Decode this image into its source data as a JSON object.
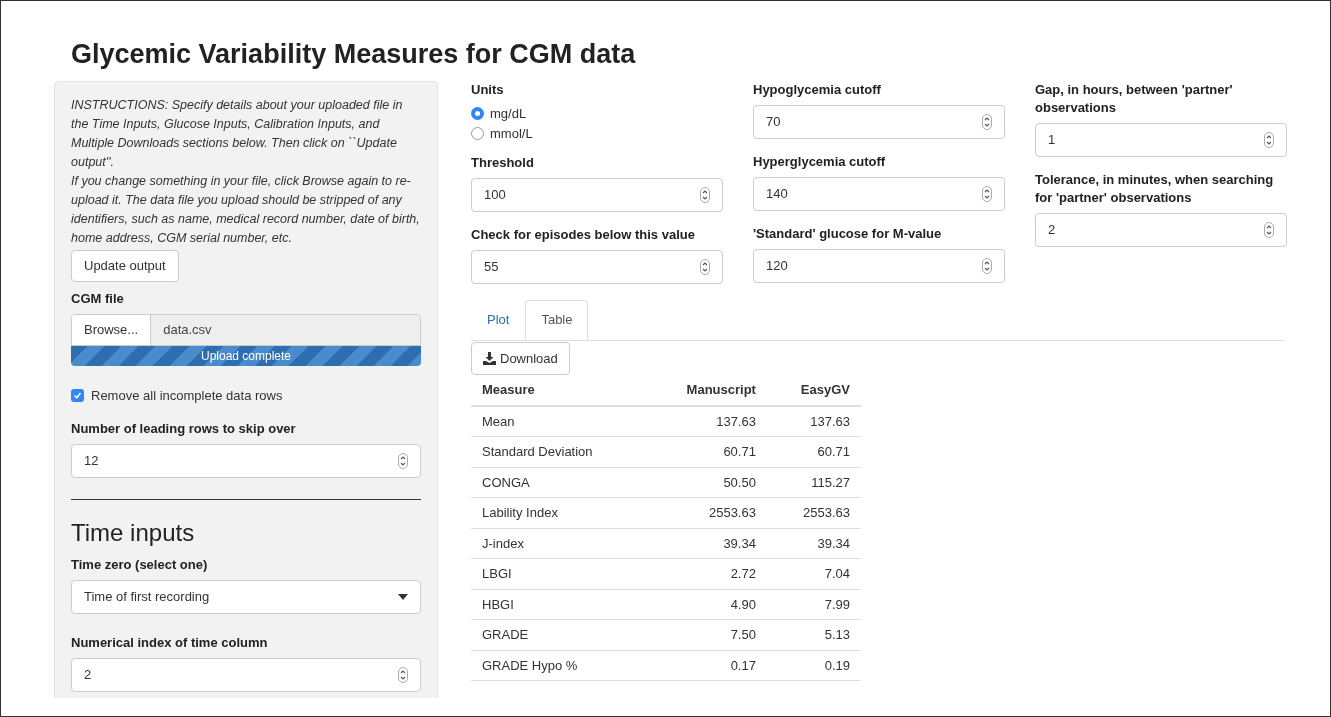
{
  "title": "Glycemic Variability Measures for CGM data",
  "sidebar": {
    "instructions": [
      "INSTRUCTIONS: Specify details about your uploaded file in the Time Inputs, Glucose Inputs, Calibration Inputs, and Multiple Downloads sections below. Then click on ``Update output''.",
      "If you change something in your file, click Browse again to re-upload it. The data file you upload should be stripped of any identifiers, such as name, medical record number, date of birth, home address, CGM serial number, etc."
    ],
    "update_button": "Update output",
    "cgm_file": {
      "label": "CGM file",
      "browse_button": "Browse...",
      "filename": "data.csv",
      "progress": {
        "label": "Upload complete",
        "level": 1
      }
    },
    "remove_incomplete": {
      "label": "Remove all incomplete data rows",
      "checked": true
    },
    "skip_rows": {
      "label": "Number of leading rows to skip over",
      "value": "12"
    },
    "section_heading": "Time inputs",
    "time_zero": {
      "label": "Time zero (select one)",
      "value": "Time of first recording"
    },
    "time_column": {
      "label": "Numerical index of time column",
      "value": "2"
    }
  },
  "settings_columns": [
    {
      "items": [
        {
          "kind": "radio",
          "label": "Units",
          "options": [
            {
              "label": "mg/dL",
              "selected": true
            },
            {
              "label": "mmol/L",
              "selected": false
            }
          ]
        },
        {
          "kind": "number",
          "label": "Threshold",
          "value": "100"
        },
        {
          "kind": "number",
          "label": "Check for episodes below this value",
          "value": "55"
        }
      ]
    },
    {
      "items": [
        {
          "kind": "number",
          "label": "Hypoglycemia cutoff",
          "value": "70"
        },
        {
          "kind": "number",
          "label": "Hyperglycemia cutoff",
          "value": "140"
        },
        {
          "kind": "number",
          "label": "'Standard' glucose for M-value",
          "value": "120"
        }
      ]
    },
    {
      "items": [
        {
          "kind": "number",
          "label": "Gap, in hours, between 'partner' observations",
          "value": "1"
        },
        {
          "kind": "number",
          "label": "Tolerance, in minutes, when searching for 'partner' observations",
          "value": "2"
        }
      ]
    }
  ],
  "tabs": [
    {
      "label": "Plot",
      "selected": false
    },
    {
      "label": "Table",
      "selected": true
    }
  ],
  "download_button": "Download",
  "table": {
    "columns": [
      "Measure",
      "Manuscript",
      "EasyGV"
    ],
    "rows": [
      [
        "Mean",
        "137.63",
        "137.63"
      ],
      [
        "Standard Deviation",
        "60.71",
        "60.71"
      ],
      [
        "CONGA",
        "50.50",
        "115.27"
      ],
      [
        "Lability Index",
        "2553.63",
        "2553.63"
      ],
      [
        "J-index",
        "39.34",
        "39.34"
      ],
      [
        "LBGI",
        "2.72",
        "7.04"
      ],
      [
        "HBGI",
        "4.90",
        "7.99"
      ],
      [
        "GRADE",
        "7.50",
        "5.13"
      ],
      [
        "GRADE Hypo %",
        "0.17",
        "0.19"
      ]
    ]
  }
}
